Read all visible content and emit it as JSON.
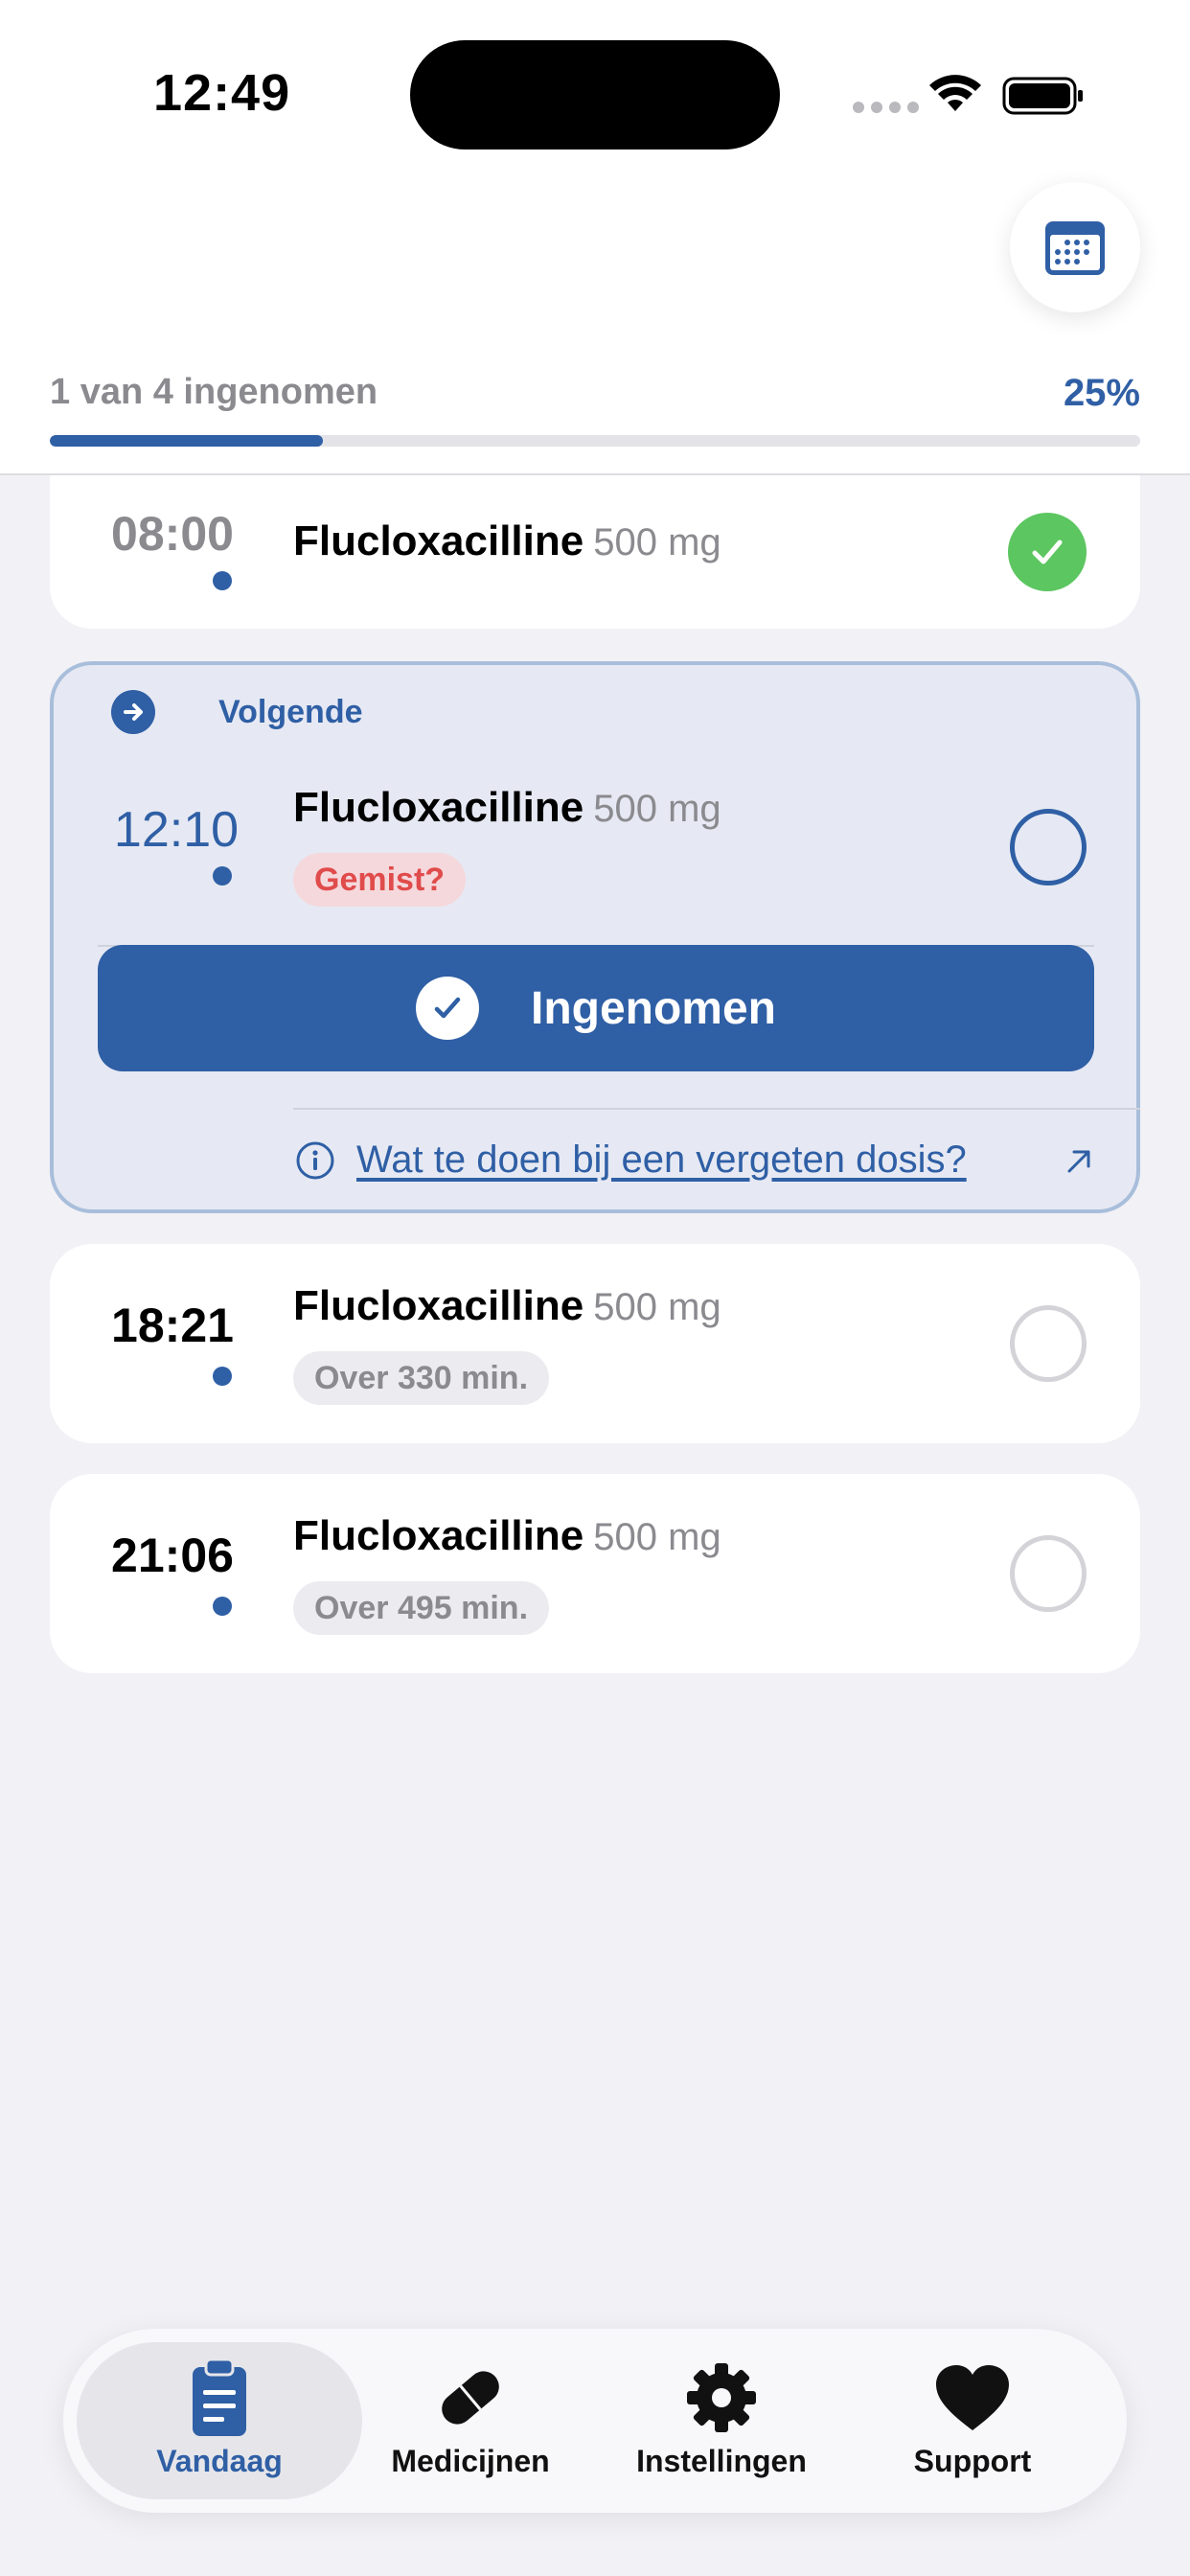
{
  "status_bar": {
    "time": "12:49"
  },
  "progress": {
    "label": "1 van 4 ingenomen",
    "percent_text": "25%",
    "fraction": 0.25
  },
  "doses": [
    {
      "time": "08:00",
      "name": "Flucloxacilline",
      "dose": "500 mg",
      "taken": true
    },
    {
      "time": "12:10",
      "name": "Flucloxacilline",
      "dose": "500 mg",
      "badge": "Gemist?",
      "taken": false
    },
    {
      "time": "18:21",
      "name": "Flucloxacilline",
      "dose": "500 mg",
      "badge": "Over 330 min.",
      "taken": false
    },
    {
      "time": "21:06",
      "name": "Flucloxacilline",
      "dose": "500 mg",
      "badge": "Over 495 min.",
      "taken": false
    }
  ],
  "next": {
    "label": "Volgende",
    "take_button": "Ingenomen",
    "info_link": "Wat te doen bij een vergeten dosis?"
  },
  "tabs": [
    {
      "label": "Vandaag",
      "icon": "clipboard-icon",
      "active": true
    },
    {
      "label": "Medicijnen",
      "icon": "pill-icon",
      "active": false
    },
    {
      "label": "Instellingen",
      "icon": "gear-icon",
      "active": false
    },
    {
      "label": "Support",
      "icon": "heart-icon",
      "active": false
    }
  ],
  "colors": {
    "accent": "#2f5fa5",
    "success": "#5cc660",
    "missed": "#e04b4b",
    "background": "#f1f1f6"
  }
}
